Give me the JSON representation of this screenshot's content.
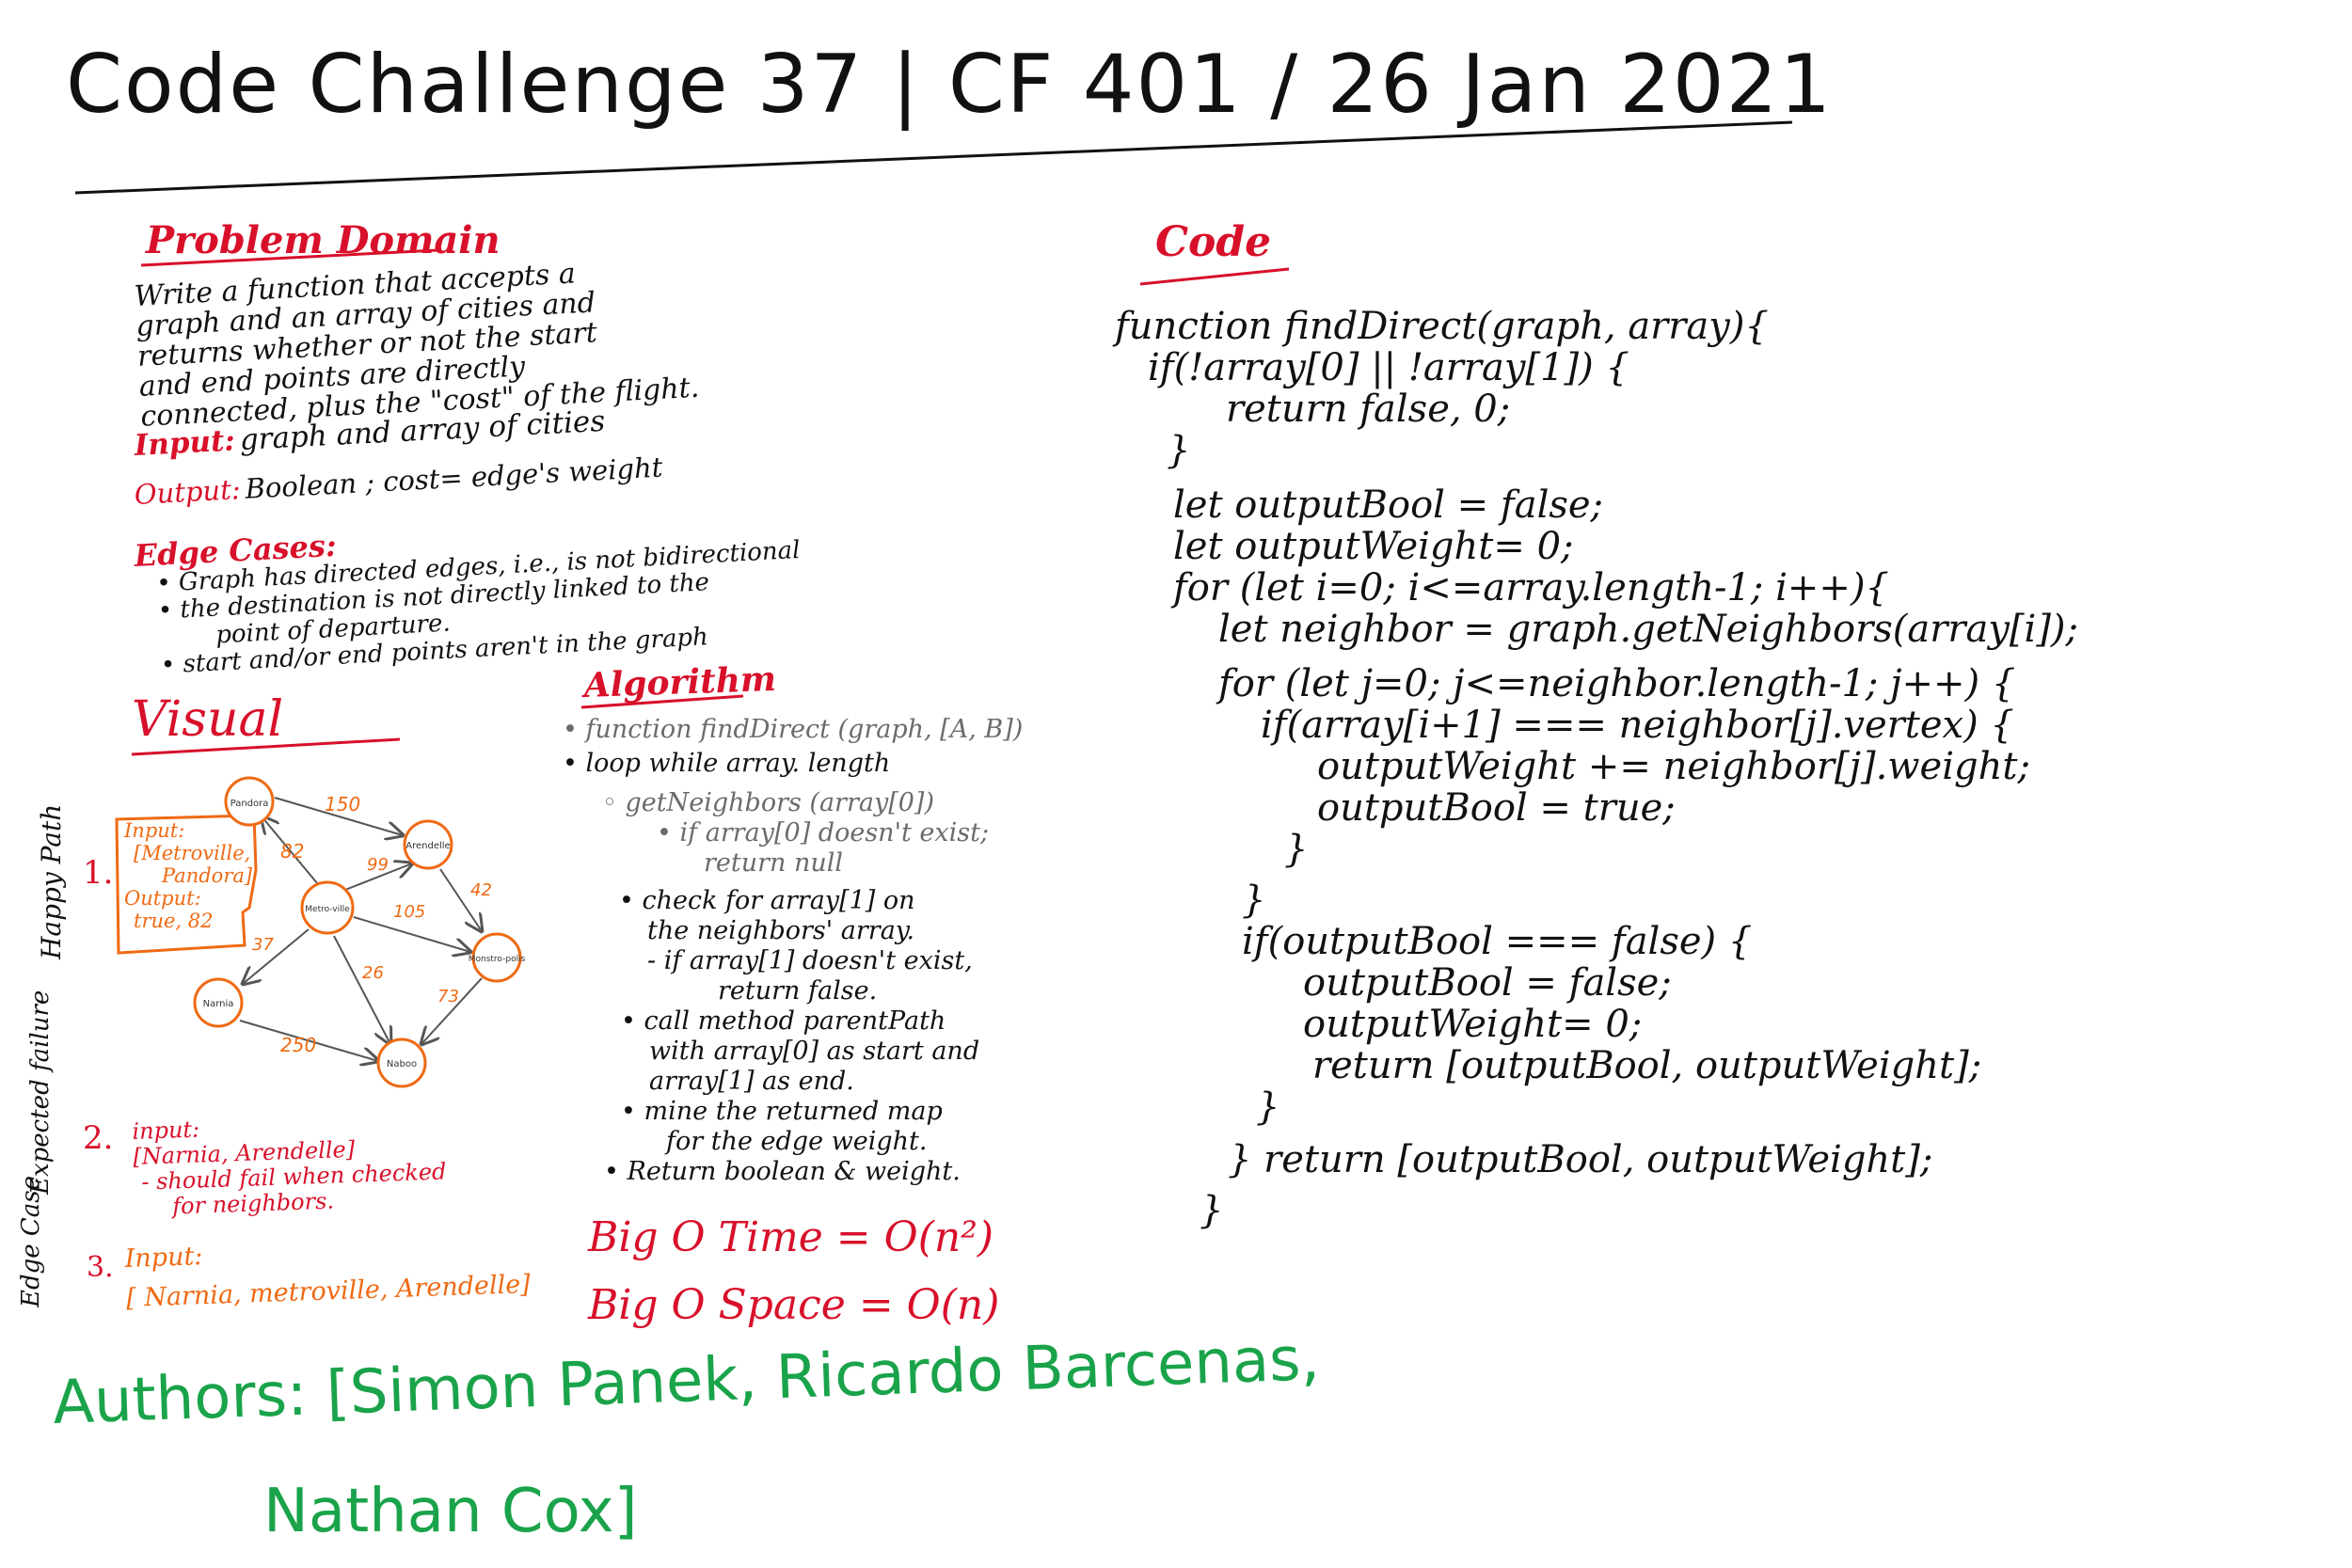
{
  "title": "Code Challenge 37 | CF 401 / 26 Jan 2021",
  "problem_domain": {
    "heading": "Problem Domain",
    "lines": [
      "Write a function that accepts a",
      "graph and an array of cities and",
      "returns whether or not the start",
      "and end points are directly",
      "connected, plus the \"cost\" of the flight."
    ],
    "input_label": "Input:",
    "input_value": "graph and array of cities",
    "output_label": "Output:",
    "output_value": "Boolean ; cost= edge's weight"
  },
  "edge_cases": {
    "heading": "Edge Cases:",
    "items": [
      "• Graph has directed edges, i.e., is not bidirectional",
      "• the destination is not directly linked to the",
      "point of departure.",
      "• start and/or end points aren't in the graph"
    ]
  },
  "visual": {
    "heading": "Visual",
    "happy_path_label": "Happy Path",
    "case1_number": "1.",
    "case1_box": [
      "Input:",
      "[Metroville,",
      "Pandora]",
      "Output:",
      "true, 82"
    ],
    "graph": {
      "nodes": [
        "Pandora",
        "Arendelle",
        "Metro-ville",
        "Monstro-polis",
        "Narnia",
        "Naboo"
      ],
      "edge_weights": [
        "150",
        "82",
        "99",
        "42",
        "105",
        "37",
        "26",
        "73",
        "250"
      ]
    },
    "expected_failure_label": "Expected failure",
    "case2_number": "2.",
    "case2_lines": [
      "input:",
      "[Narnia, Arendelle]",
      "- should fail when checked",
      "for neighbors."
    ],
    "edge_case_label": "Edge Case",
    "case3_number": "3.",
    "case3_lines": [
      "Input:",
      "[ Narnia, metroville, Arendelle]"
    ]
  },
  "algorithm": {
    "heading": "Algorithm",
    "lines": [
      "• function findDirect (graph, [A, B])",
      "• loop while array. length",
      "◦ getNeighbors (array[0])",
      "• if array[0] doesn't exist;",
      "return null",
      "• check for array[1] on",
      "the neighbors' array.",
      "- if array[1] doesn't exist,",
      "return false.",
      "• call method parentPath",
      "with array[0] as start and",
      "array[1] as end.",
      "• mine the returned map",
      "for the edge weight.",
      "• Return boolean & weight."
    ],
    "big_o_time": "Big O Time = O(n²)",
    "big_o_space": "Big O Space = O(n)"
  },
  "authors": {
    "line1": "Authors: [Simon Panek, Ricardo Barcenas,",
    "line2": "Nathan Cox]"
  },
  "code": {
    "heading": "Code",
    "lines": [
      "function findDirect(graph, array){",
      "if(!array[0] || !array[1]) {",
      "return false, 0;",
      "}",
      "let outputBool = false;",
      "let outputWeight= 0;",
      "for (let i=0; i<=array.length-1; i++){",
      "let neighbor = graph.getNeighbors(array[i]);",
      "for (let j=0; j<=neighbor.length-1; j++) {",
      "if(array[i+1] === neighbor[j].vertex) {",
      "outputWeight += neighbor[j].weight;",
      "outputBool = true;",
      "}",
      "}",
      "if(outputBool === false) {",
      "outputBool = false;",
      "outputWeight= 0;",
      "return [outputBool, outputWeight];",
      "}",
      "} return [outputBool, outputWeight];",
      "}"
    ]
  }
}
